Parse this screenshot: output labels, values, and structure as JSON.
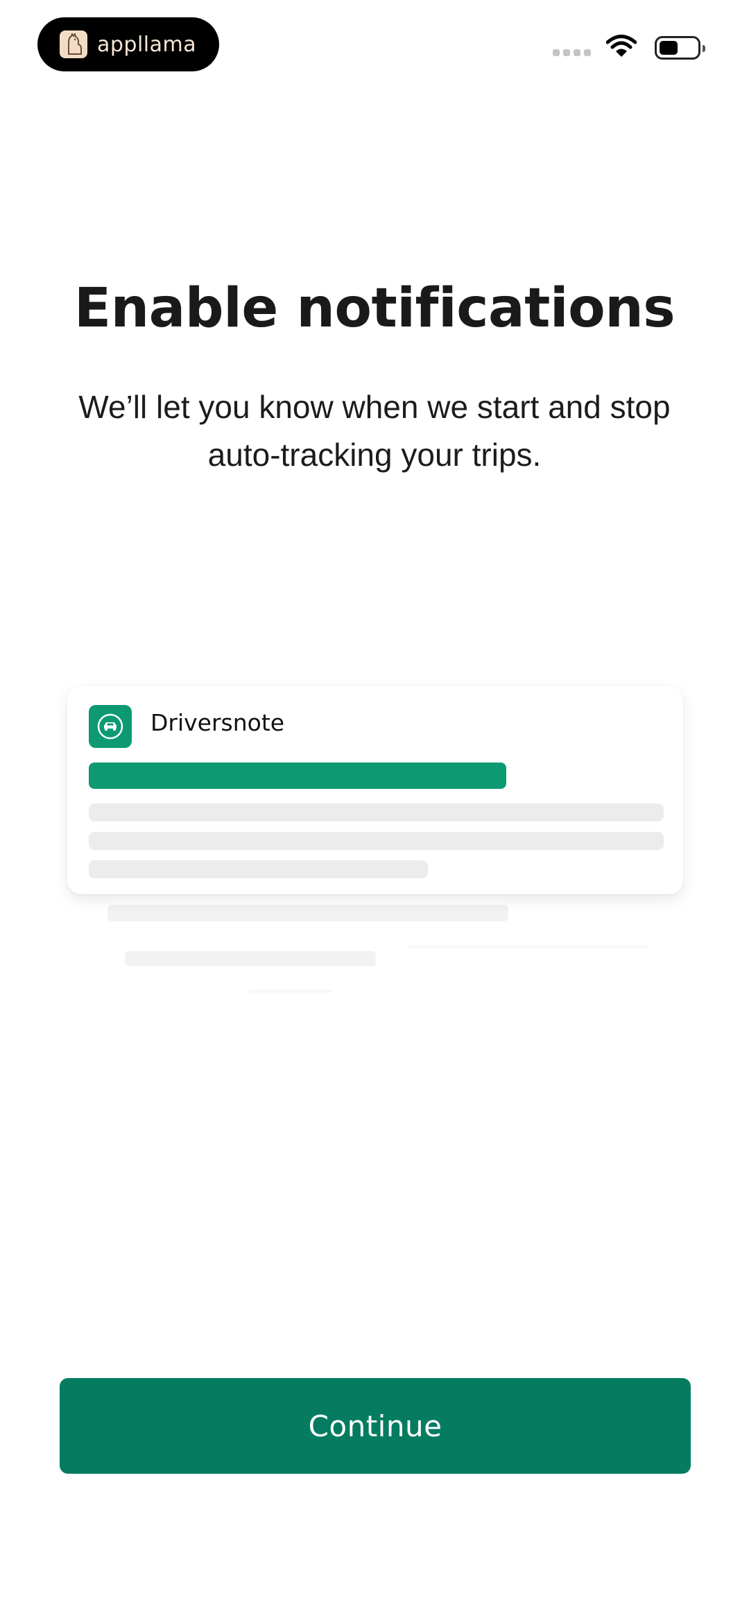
{
  "status_bar": {
    "badge_text": "appllama",
    "icons": [
      "llama-logo-icon",
      "signal-icon",
      "wifi-icon",
      "battery-icon"
    ]
  },
  "main": {
    "title": "Enable notifications",
    "subtitle": "We’ll let you know when we start and stop auto-tracking your trips."
  },
  "notification_preview": {
    "app_name": "Driversnote",
    "app_icon": "car-icon",
    "accent_color": "#0d9a73"
  },
  "footer": {
    "continue_label": "Continue",
    "button_color": "#057c60"
  }
}
